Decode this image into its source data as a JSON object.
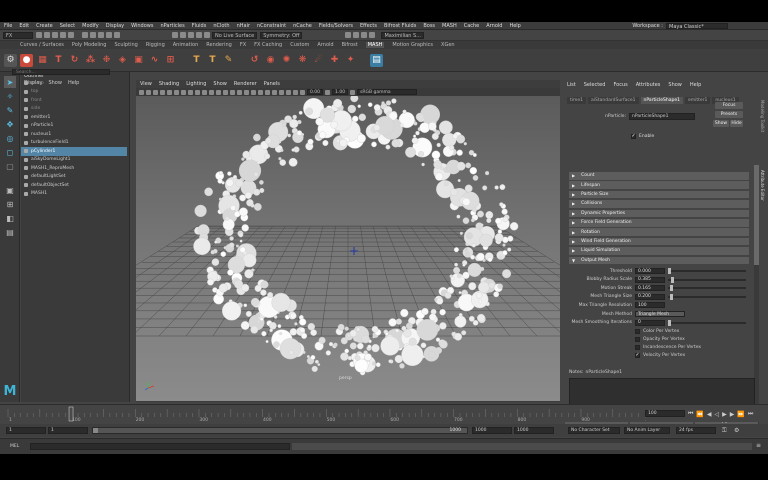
{
  "menubar": {
    "items": [
      "File",
      "Edit",
      "Create",
      "Select",
      "Modify",
      "Display",
      "Windows",
      "nParticles",
      "Fluids",
      "nCloth",
      "nHair",
      "nConstraint",
      "nCache",
      "Fields/Solvers",
      "Effects",
      "Bifrost Fluids",
      "Boss",
      "MASH",
      "Cache",
      "Arnold",
      "Help"
    ],
    "workspace_label": "Workspace :",
    "workspace_value": "Maya Classic*"
  },
  "statusline": {
    "mode": "FX",
    "live_surface": "No Live Surface",
    "symmetry": "Symmetry: Off",
    "user": "Maximilian S..."
  },
  "shelf": {
    "tabs": [
      "Curves / Surfaces",
      "Poly Modeling",
      "Sculpting",
      "Rigging",
      "Animation",
      "Rendering",
      "FX",
      "FX Caching",
      "Custom",
      "Arnold",
      "Bifrost",
      "MASH",
      "Motion Graphics",
      "XGen"
    ],
    "active_tab": "MASH"
  },
  "outliner": {
    "title": "Outliner",
    "menu": [
      "Display",
      "Show",
      "Help"
    ],
    "search_placeholder": "Search...",
    "items": [
      {
        "label": "persp",
        "dim": true
      },
      {
        "label": "top",
        "dim": true
      },
      {
        "label": "front",
        "dim": true
      },
      {
        "label": "side",
        "dim": true
      },
      {
        "label": "emitter1",
        "dim": false
      },
      {
        "label": "nParticle1",
        "dim": false
      },
      {
        "label": "nucleus1",
        "dim": false
      },
      {
        "label": "turbulenceField1",
        "dim": false
      },
      {
        "label": "pCylinder1",
        "dim": false,
        "selected": true
      },
      {
        "label": "aiSkyDomeLight1",
        "dim": false
      },
      {
        "label": "MASH1_ReproMesh",
        "dim": false
      },
      {
        "label": "defaultLightSet",
        "dim": false
      },
      {
        "label": "defaultObjectSet",
        "dim": false
      },
      {
        "label": "MASH1",
        "dim": false
      }
    ]
  },
  "viewport": {
    "menu": [
      "View",
      "Shading",
      "Lighting",
      "Show",
      "Renderer",
      "Panels"
    ],
    "field1": "0.00",
    "field2": "1.00",
    "color_space": "sRGB gamma",
    "camera_label": "persp"
  },
  "attribute_editor": {
    "menu": [
      "List",
      "Selected",
      "Focus",
      "Attributes",
      "Show",
      "Help"
    ],
    "tabs": [
      "time1",
      "aiStandardSurface1",
      "nParticleShape1",
      "emitter1",
      "nucleus1"
    ],
    "active_tab": "nParticleShape1",
    "node_label": "nParticle:",
    "node_value": "nParticleShape1",
    "focus_button": "Focus",
    "presets_button": "Presets",
    "show_button": "Show",
    "hide_button": "Hide",
    "enable_label": "Enable",
    "sections": [
      "Count",
      "Lifespan",
      "Particle Size",
      "Collisions",
      "Dynamic Properties",
      "Force Field Generation",
      "Rotation",
      "Wind Field Generation",
      "Liquid Simulation",
      "Output Mesh"
    ],
    "output_mesh": [
      {
        "label": "Threshold",
        "value": "0.000",
        "level": 0.0
      },
      {
        "label": "Blobby Radius Scale",
        "value": "0.385",
        "level": 0.04
      },
      {
        "label": "Motion Streak",
        "value": "0.165",
        "level": 0.02
      },
      {
        "label": "Mesh Triangle Size",
        "value": "0.200",
        "level": 0.02
      },
      {
        "label": "Max Triangle Resolution",
        "value": "100",
        "level": null
      },
      {
        "label": "Mesh Method",
        "value": "Triangle Mesh",
        "level": null
      },
      {
        "label": "Mesh Smoothing Iterations",
        "value": "0",
        "level": 0.0
      }
    ],
    "checkboxes": [
      {
        "label": "Color Per Vertex",
        "checked": false
      },
      {
        "label": "Opacity Per Vertex",
        "checked": false
      },
      {
        "label": "Incandescence Per Vertex",
        "checked": false
      },
      {
        "label": "Velocity Per Vertex",
        "checked": true
      }
    ],
    "notes_label": "Notes:",
    "notes_value": "nParticleShape1",
    "bottom_buttons": [
      "Select",
      "Load Attributes",
      "Copy Tab"
    ],
    "side_tabs": [
      "Modeling Toolkit",
      "Attribute Editor"
    ]
  },
  "timeline": {
    "current_frame": "100",
    "ticks": [
      "1",
      "100",
      "200",
      "300",
      "400",
      "500",
      "600",
      "700",
      "800",
      "900",
      "1000"
    ],
    "playhead_frame": 100
  },
  "range": {
    "start": "1",
    "inner_start": "1",
    "slider_end": "1000",
    "end": "1000",
    "outer_end": "1000",
    "character_set": "No Character Set",
    "anim_layer": "No Anim Layer",
    "fps": "24 fps"
  },
  "cmdline": {
    "label": "MEL"
  },
  "colors": {
    "selection": "#5285a6",
    "accent_blue": "#5dc1e8",
    "background": "#444444"
  }
}
